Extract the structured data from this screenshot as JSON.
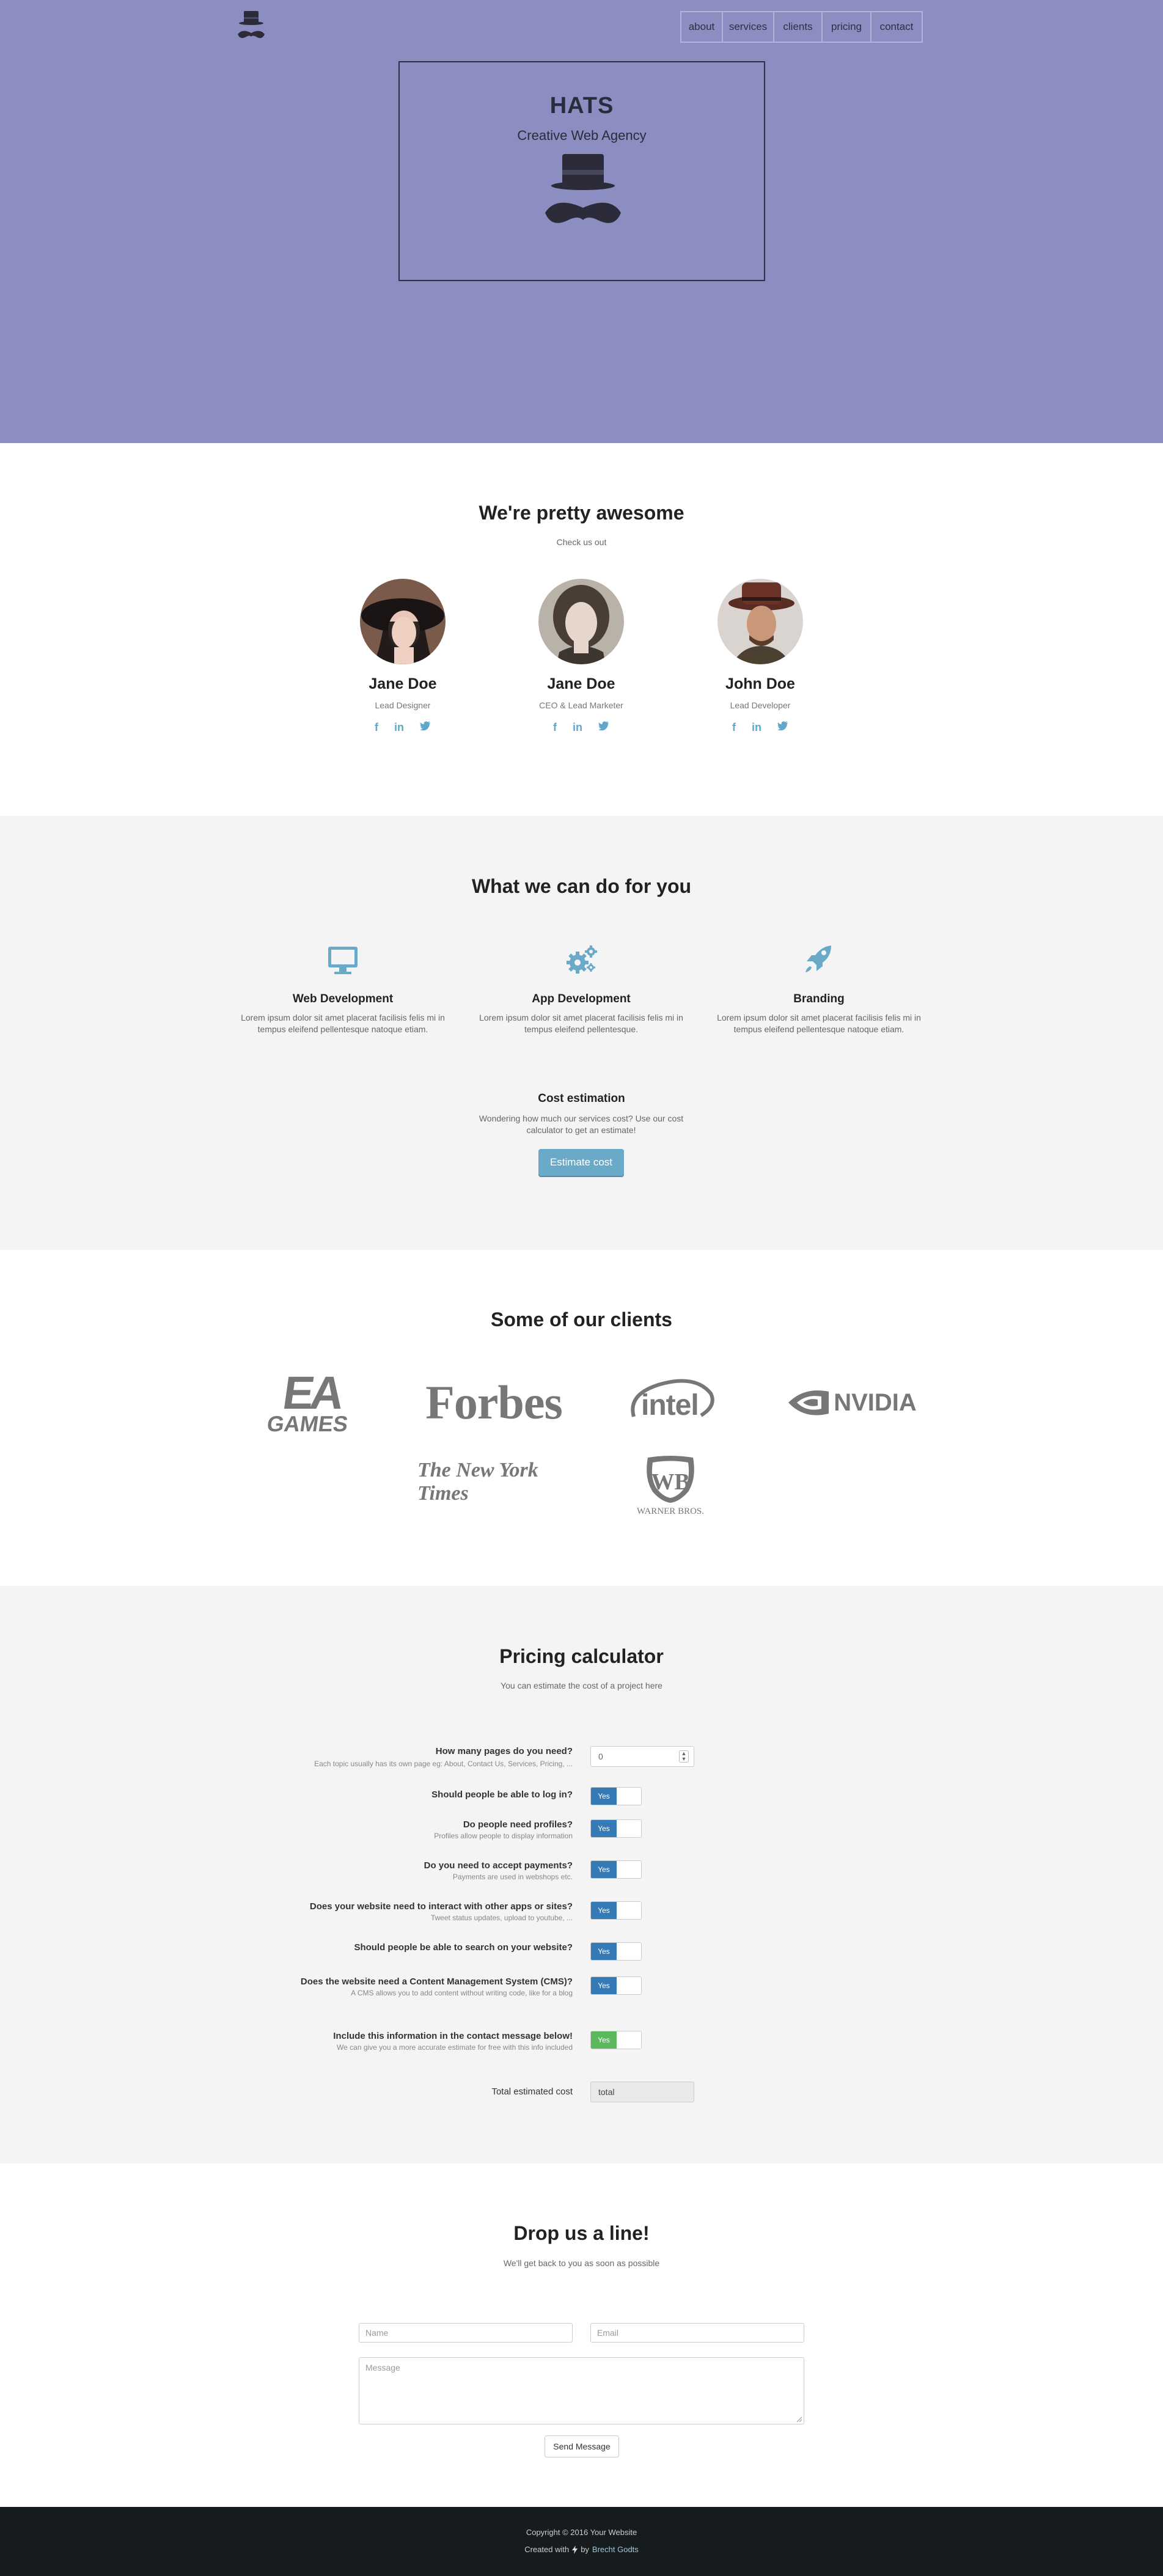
{
  "nav": {
    "items": [
      "about",
      "services",
      "clients",
      "pricing",
      "contact"
    ]
  },
  "hero": {
    "title": "HATS",
    "subtitle": "Creative Web Agency"
  },
  "team": {
    "title": "We're pretty awesome",
    "subtitle": "Check us out",
    "members": [
      {
        "name": "Jane Doe",
        "role": "Lead Designer"
      },
      {
        "name": "Jane Doe",
        "role": "CEO & Lead Marketer"
      },
      {
        "name": "John Doe",
        "role": "Lead Developer"
      }
    ],
    "social": [
      "f",
      "in",
      "twitter"
    ]
  },
  "services": {
    "title": "What we can do for you",
    "items": [
      {
        "title": "Web Development",
        "text": "Lorem ipsum dolor sit amet placerat facilisis felis mi in tempus eleifend pellentesque natoque etiam.",
        "icon": "desktop-icon"
      },
      {
        "title": "App Development",
        "text": "Lorem ipsum dolor sit amet placerat facilisis felis mi in tempus eleifend pellentesque.",
        "icon": "gears-icon"
      },
      {
        "title": "Branding",
        "text": "Lorem ipsum dolor sit amet placerat facilisis felis mi in tempus eleifend pellentesque natoque etiam.",
        "icon": "rocket-icon"
      }
    ],
    "cost": {
      "title": "Cost estimation",
      "text": "Wondering how much our services cost? Use our cost calculator to get an estimate!",
      "button": "Estimate cost"
    }
  },
  "clients": {
    "title": "Some of our clients",
    "logos": [
      "EA GAMES",
      "Forbes",
      "intel",
      "NVIDIA",
      "The New York Times",
      "WARNER BROS."
    ],
    "ea_top": "EA",
    "ea_bottom": "GAMES",
    "wb_letters": "WB"
  },
  "pricing": {
    "title": "Pricing calculator",
    "subtitle": "You can estimate the cost of a project here",
    "pages": {
      "label": "How many pages do you need?",
      "hint": "Each topic usually has its own page eg: About, Contact Us, Services, Pricing, ...",
      "value": "0"
    },
    "questions": [
      {
        "label": "Should people be able to log in?",
        "hint": "",
        "toggle": "Yes"
      },
      {
        "label": "Do people need profiles?",
        "hint": "Profiles allow people to display information",
        "toggle": "Yes"
      },
      {
        "label": "Do you need to accept payments?",
        "hint": "Payments are used in webshops etc.",
        "toggle": "Yes"
      },
      {
        "label": "Does your website need to interact with other apps or sites?",
        "hint": "Tweet status updates, upload to youtube, ...",
        "toggle": "Yes"
      },
      {
        "label": "Should people be able to search on your website?",
        "hint": "",
        "toggle": "Yes"
      },
      {
        "label": "Does the website need a Content Management System (CMS)?",
        "hint": "A CMS allows you to add content without writing code, like for a blog",
        "toggle": "Yes"
      }
    ],
    "include": {
      "label": "Include this information in the contact message below!",
      "hint": "We can give you a more accurate estimate for free with this info included",
      "toggle": "Yes"
    },
    "total": {
      "label": "Total estimated cost",
      "value": "total"
    }
  },
  "contact": {
    "title": "Drop us a line!",
    "subtitle": "We'll get back to you as soon as possible",
    "name_placeholder": "Name",
    "email_placeholder": "Email",
    "message_placeholder": "Message",
    "button": "Send Message"
  },
  "footer": {
    "copyright": "Copyright © 2016 Your Website",
    "created_prefix": "Created with",
    "created_by": "by",
    "author": "Brecht Godts"
  },
  "colors": {
    "hero_bg": "#8c8dc0",
    "accent": "#5fa8cc",
    "toggle_blue": "#337ab7",
    "toggle_green": "#5cb85c",
    "footer_bg": "#161b1d"
  }
}
